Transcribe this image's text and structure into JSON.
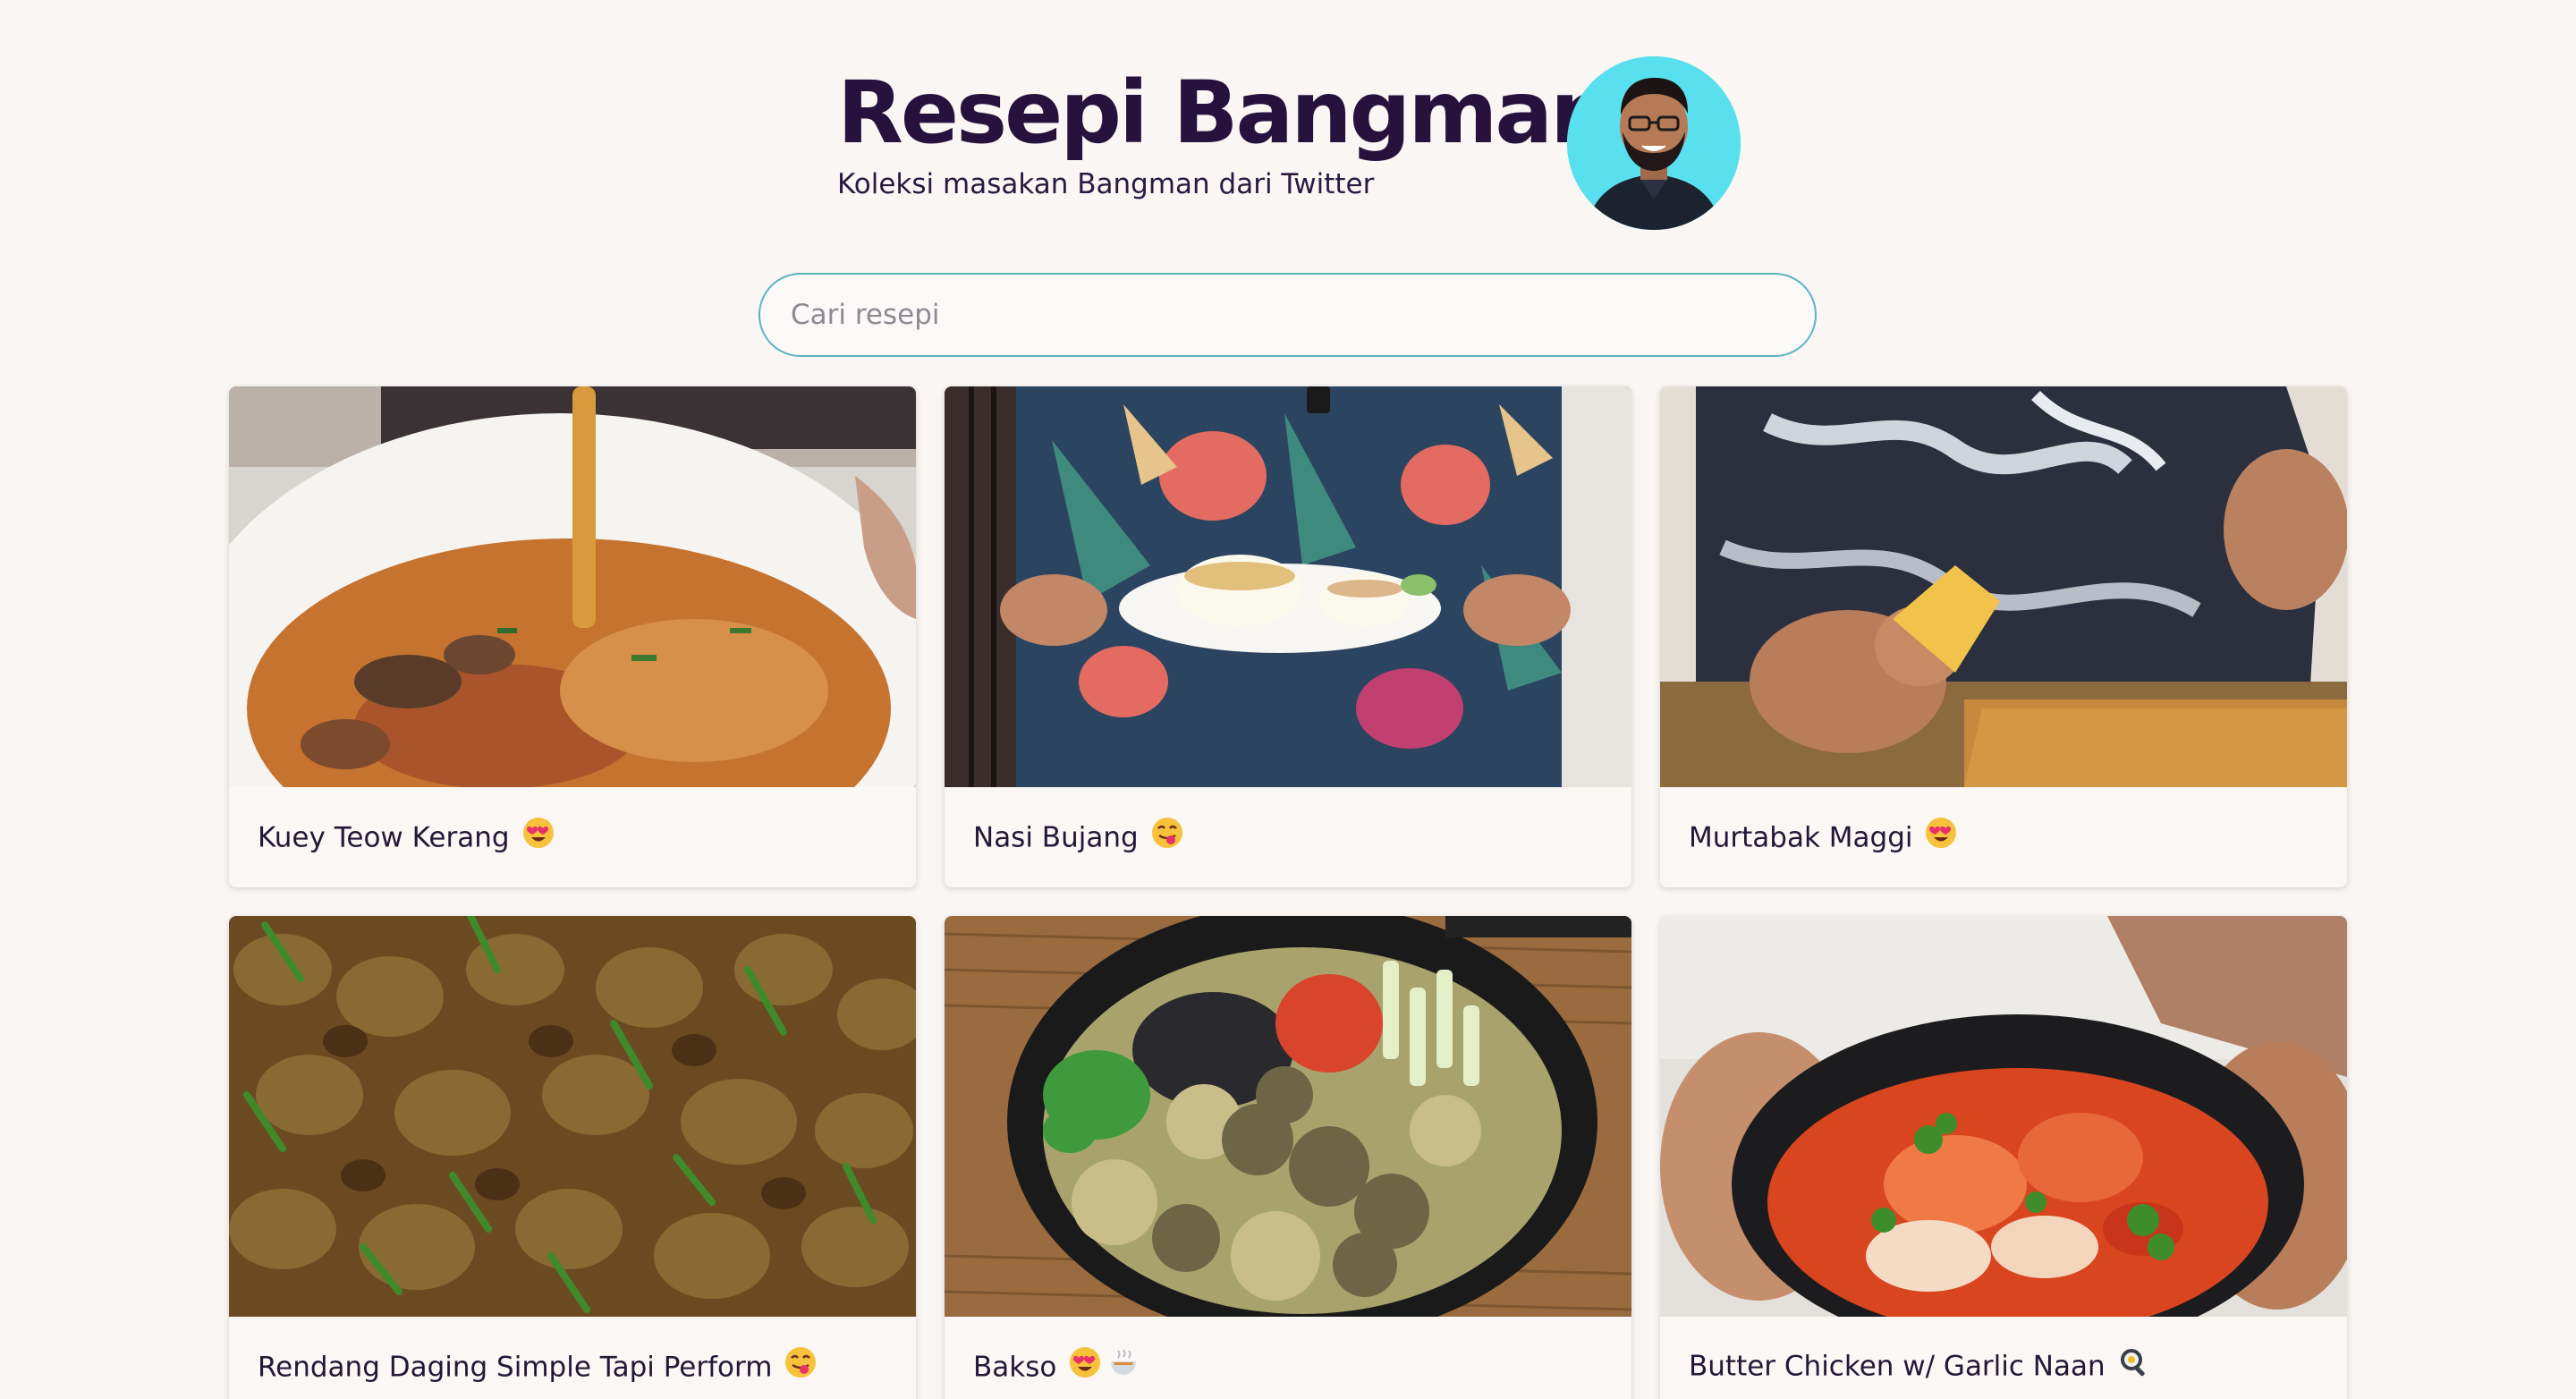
{
  "site": {
    "title": "Resepi Bangman",
    "subtitle": "Koleksi masakan Bangman dari Twitter",
    "avatar_icon": "chef-portrait"
  },
  "search": {
    "placeholder": "Cari resepi",
    "value": "",
    "border_color": "#5ab4c1"
  },
  "recipes": [
    {
      "title": "Kuey Teow Kerang",
      "emojis": [
        "heart-eyes-face-icon"
      ]
    },
    {
      "title": "Nasi Bujang",
      "emojis": [
        "tongue-face-icon"
      ]
    },
    {
      "title": "Murtabak Maggi",
      "emojis": [
        "heart-eyes-face-icon"
      ]
    },
    {
      "title": "Rendang Daging Simple Tapi Perform",
      "emojis": [
        "tongue-face-icon"
      ]
    },
    {
      "title": "Bakso",
      "emojis": [
        "heart-eyes-face-icon",
        "steaming-bowl-icon"
      ]
    },
    {
      "title": "Butter Chicken w/ Garlic Naan",
      "emojis": [
        "cooking-pan-icon"
      ]
    }
  ],
  "colors": {
    "background": "#f9f6f3",
    "title": "#26123d",
    "avatar_bg": "#59e0ee"
  }
}
